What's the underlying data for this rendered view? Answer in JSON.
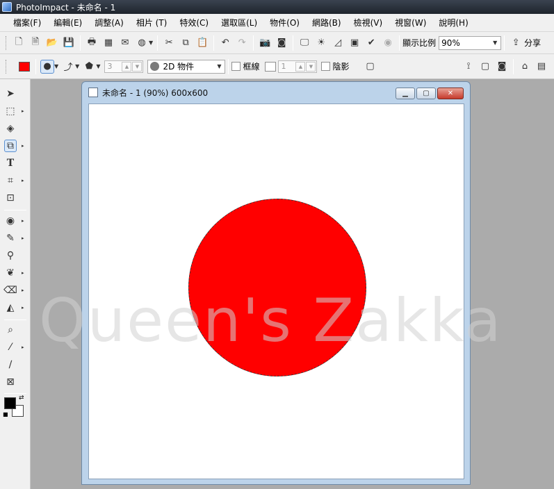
{
  "window": {
    "title": "PhotoImpact - 未命名 - 1"
  },
  "menu": [
    "檔案(F)",
    "編輯(E)",
    "調整(A)",
    "相片 (T)",
    "特效(C)",
    "選取區(L)",
    "物件(O)",
    "網路(B)",
    "檢視(V)",
    "視窗(W)",
    "說明(H)"
  ],
  "toolbar": {
    "zoom_label": "顯示比例",
    "zoom_value": "90%",
    "share_label": "分享"
  },
  "attrbar": {
    "color": "#ff0000",
    "size_value": "3",
    "mode_value": "2D 物件",
    "border_label": "框線",
    "border_value": "1",
    "shadow_label": "陰影"
  },
  "document": {
    "title": "未命名 - 1 (90%) 600x600",
    "shape_color": "#ff0000",
    "watermark": "Queen's Zakka"
  },
  "colors": {
    "foreground": "#000000",
    "background": "#ffffff"
  }
}
